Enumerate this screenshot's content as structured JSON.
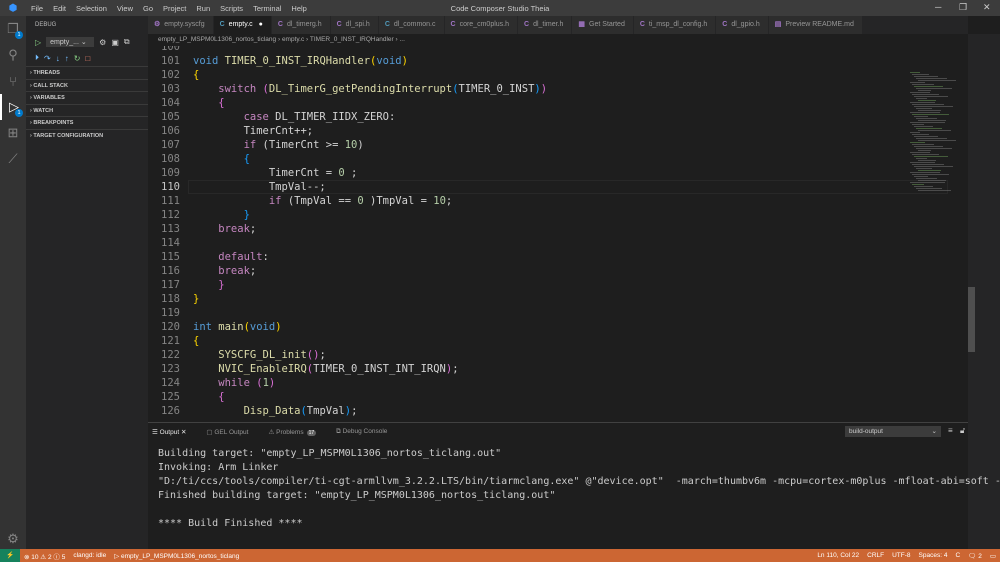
{
  "window": {
    "title": "Code Composer Studio Theia",
    "menu": [
      "File",
      "Edit",
      "Selection",
      "View",
      "Go",
      "Project",
      "Run",
      "Scripts",
      "Terminal",
      "Help"
    ]
  },
  "activity": {
    "explorer_badge": "1",
    "debug_badge": "1"
  },
  "sidebar": {
    "title": "DEBUG",
    "config": "empty_...",
    "sections": [
      "THREADS",
      "CALL STACK",
      "VARIABLES",
      "WATCH",
      "BREAKPOINTS",
      "TARGET CONFIGURATION"
    ]
  },
  "tabs": [
    {
      "label": "empty.syscfg",
      "icon": "⚙"
    },
    {
      "label": "empty.c",
      "icon": "C",
      "active": true,
      "dirty": "●"
    },
    {
      "label": "dl_timerg.h",
      "icon": "C"
    },
    {
      "label": "dl_spi.h",
      "icon": "C"
    },
    {
      "label": "dl_common.c",
      "icon": "C"
    },
    {
      "label": "core_cm0plus.h",
      "icon": "C"
    },
    {
      "label": "dl_timer.h",
      "icon": "C"
    },
    {
      "label": "Get Started",
      "icon": "▦"
    },
    {
      "label": "ti_msp_dl_config.h",
      "icon": "C"
    },
    {
      "label": "dl_gpio.h",
      "icon": "C"
    },
    {
      "label": "Preview README.md",
      "icon": "▤"
    }
  ],
  "breadcrumb": [
    "empty_LP_MSPM0L1306_nortos_ticlang",
    "empty.c",
    "TIMER_0_INST_IRQHandler",
    "..."
  ],
  "editor": {
    "current_line": "110",
    "lines": [
      {
        "n": "100",
        "t": []
      },
      {
        "n": "101",
        "t": [
          [
            "void",
            "k"
          ],
          [
            " TIMER_0_INST_IRQHandler",
            "f"
          ],
          [
            "(",
            "b"
          ],
          [
            "void",
            "k"
          ],
          [
            ")",
            "b"
          ]
        ]
      },
      {
        "n": "102",
        "t": [
          [
            "{",
            "b"
          ]
        ]
      },
      {
        "n": "103",
        "t": [
          [
            "    switch",
            "c"
          ],
          [
            " ",
            ""
          ],
          [
            "(",
            "b2"
          ],
          [
            "DL_TimerG_getPendingInterrupt",
            "f"
          ],
          [
            "(",
            "b3"
          ],
          [
            "TIMER_0_INST",
            ""
          ],
          [
            ")",
            "b3"
          ],
          [
            ")",
            "b2"
          ]
        ]
      },
      {
        "n": "104",
        "t": [
          [
            "    {",
            "b2"
          ]
        ]
      },
      {
        "n": "105",
        "t": [
          [
            "        case",
            "c"
          ],
          [
            " DL_TIMER_IIDX_ZERO:",
            ""
          ]
        ]
      },
      {
        "n": "106",
        "t": [
          [
            "        TimerCnt++;",
            ""
          ]
        ]
      },
      {
        "n": "107",
        "t": [
          [
            "        if",
            "c"
          ],
          [
            " (TimerCnt >= ",
            ""
          ],
          [
            "10",
            "n"
          ],
          [
            ")",
            ""
          ]
        ]
      },
      {
        "n": "108",
        "t": [
          [
            "        {",
            "b3"
          ]
        ]
      },
      {
        "n": "109",
        "t": [
          [
            "            TimerCnt = ",
            ""
          ],
          [
            "0",
            "n"
          ],
          [
            " ;",
            ""
          ]
        ]
      },
      {
        "n": "110",
        "t": [
          [
            "            TmpVal--;",
            ""
          ]
        ]
      },
      {
        "n": "111",
        "t": [
          [
            "            if",
            "c"
          ],
          [
            " (TmpVal == ",
            ""
          ],
          [
            "0",
            "n"
          ],
          [
            " )TmpVal = ",
            ""
          ],
          [
            "10",
            "n"
          ],
          [
            ";",
            ""
          ]
        ]
      },
      {
        "n": "112",
        "t": [
          [
            "        }",
            "b3"
          ]
        ]
      },
      {
        "n": "113",
        "t": [
          [
            "    break",
            "c"
          ],
          [
            ";",
            ""
          ]
        ]
      },
      {
        "n": "114",
        "t": []
      },
      {
        "n": "115",
        "t": [
          [
            "    default",
            "c"
          ],
          [
            ":",
            ""
          ]
        ]
      },
      {
        "n": "116",
        "t": [
          [
            "    break",
            "c"
          ],
          [
            ";",
            ""
          ]
        ]
      },
      {
        "n": "117",
        "t": [
          [
            "    }",
            "b2"
          ]
        ]
      },
      {
        "n": "118",
        "t": [
          [
            "}",
            "b"
          ]
        ]
      },
      {
        "n": "119",
        "t": []
      },
      {
        "n": "120",
        "t": [
          [
            "int",
            "k"
          ],
          [
            " main",
            "f"
          ],
          [
            "(",
            "b"
          ],
          [
            "void",
            "k"
          ],
          [
            ")",
            "b"
          ]
        ]
      },
      {
        "n": "121",
        "t": [
          [
            "{",
            "b"
          ]
        ]
      },
      {
        "n": "122",
        "t": [
          [
            "    SYSCFG_DL_init",
            "f"
          ],
          [
            "(",
            "b2"
          ],
          [
            ")",
            "b2"
          ],
          [
            ";",
            ""
          ]
        ]
      },
      {
        "n": "123",
        "t": [
          [
            "    NVIC_EnableIRQ",
            "f"
          ],
          [
            "(",
            "b2"
          ],
          [
            "TIMER_0_INST_INT_IRQN",
            ""
          ],
          [
            ")",
            "b2"
          ],
          [
            ";",
            ""
          ]
        ]
      },
      {
        "n": "124",
        "t": [
          [
            "    while",
            "c"
          ],
          [
            " ",
            ""
          ],
          [
            "(",
            "b2"
          ],
          [
            "1",
            "n"
          ],
          [
            ")",
            "b2"
          ]
        ]
      },
      {
        "n": "125",
        "t": [
          [
            "    {",
            "b2"
          ]
        ]
      },
      {
        "n": "126",
        "t": [
          [
            "        Disp_Data",
            "f"
          ],
          [
            "(",
            "b3"
          ],
          [
            "TmpVal",
            ""
          ],
          [
            ")",
            "b3"
          ],
          [
            ";",
            ""
          ]
        ]
      }
    ]
  },
  "panel": {
    "tabs": [
      "Output",
      "GEL Output",
      "Problems",
      "Debug Console"
    ],
    "problems_count": "17",
    "channel": "build-output",
    "output": [
      "Building target: \"empty_LP_MSPM0L1306_nortos_ticlang.out\"",
      "Invoking: Arm Linker",
      "\"D:/ti/ccs/tools/compiler/ti-cgt-armllvm_3.2.2.LTS/bin/tiarmclang.exe\" @\"device.opt\"  -march=thumbv6m -mcpu=cortex-m0plus -mfloat-abi=soft -mli",
      "Finished building target: \"empty_LP_MSPM0L1306_nortos_ticlang.out\"",
      "",
      "**** Build Finished ****"
    ]
  },
  "status": {
    "errors": "10",
    "warnings": "2",
    "infos": "5",
    "clangd": "clangd: idle",
    "project": "empty_LP_MSPM0L1306_nortos_ticlang",
    "position": "Ln 110, Col 22",
    "eol": "CRLF",
    "encoding": "UTF-8",
    "spaces": "Spaces: 4",
    "language": "C",
    "notifications": "2"
  },
  "colors": {
    "status_bar": "#cc6633",
    "accent": "#007acc"
  }
}
